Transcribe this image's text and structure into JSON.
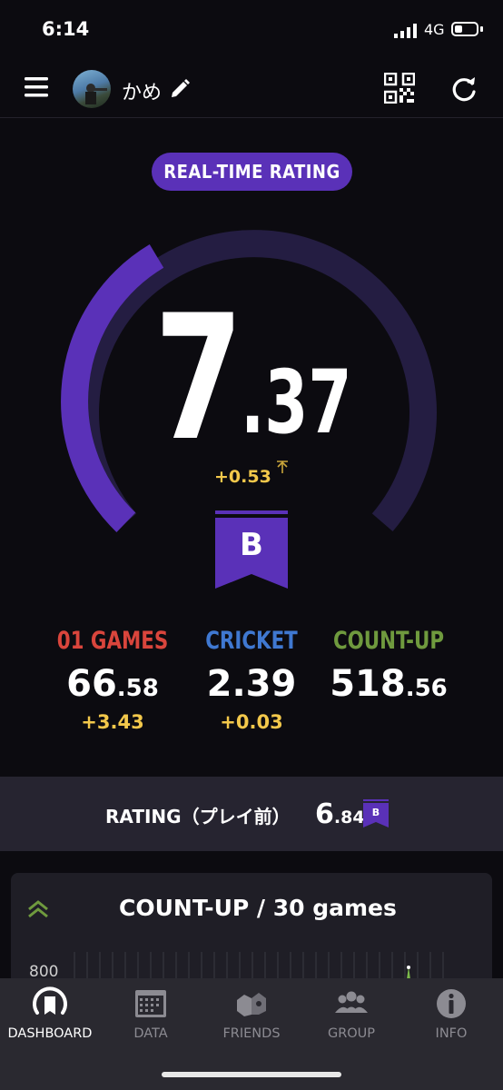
{
  "status": {
    "time": "6:14",
    "network": "4G"
  },
  "header": {
    "username": "かめ"
  },
  "rating": {
    "label": "REAL-TIME RATING",
    "integer": "7",
    "decimal": ".37",
    "delta": "+0.53",
    "rank": "B"
  },
  "stats": [
    {
      "label": "01 GAMES",
      "color": "#d9453c",
      "big": "66",
      "small": ".58",
      "delta": "+3.43"
    },
    {
      "label": "CRICKET",
      "color": "#3f78d1",
      "big": "2.39",
      "small": "",
      "delta": "+0.03"
    },
    {
      "label": "COUNT-UP",
      "color": "#6f9a3e",
      "big": "518",
      "small": ".56",
      "delta": ""
    }
  ],
  "rating_before": {
    "label": "RATING（プレイ前）",
    "big": "6",
    "small": ".84",
    "rank": "B"
  },
  "card": {
    "title": "COUNT-UP / 30 games",
    "axis_label": "800"
  },
  "tabs": [
    {
      "label": "DASHBOARD",
      "icon": "dashboard-icon"
    },
    {
      "label": "DATA",
      "icon": "calendar-icon"
    },
    {
      "label": "FRIENDS",
      "icon": "friends-icon"
    },
    {
      "label": "GROUP",
      "icon": "group-icon"
    },
    {
      "label": "INFO",
      "icon": "info-icon"
    }
  ],
  "colors": {
    "accent": "#5a31b8",
    "delta": "#f3c84b",
    "background": "#0c0b10"
  }
}
